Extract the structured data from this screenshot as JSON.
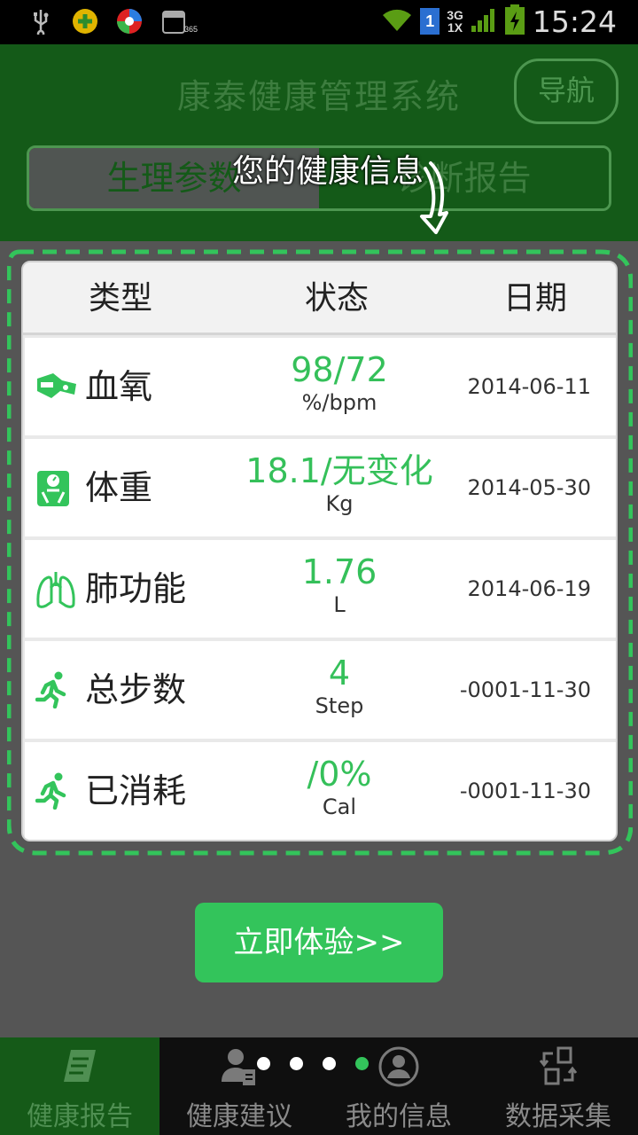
{
  "status_bar": {
    "time": "15:24",
    "network_top": "3G",
    "network_bottom": "1X",
    "sim": "1",
    "calendar_badge": "365",
    "icons": [
      "usb-icon",
      "plus-app-icon",
      "colorful-app-icon",
      "calendar-icon",
      "wifi-icon",
      "sim-icon",
      "signal-icon",
      "battery-charging-icon"
    ]
  },
  "header": {
    "title": "康泰健康管理系统",
    "nav_button": "导航",
    "tabs": [
      {
        "label": "生理参数",
        "active": true
      },
      {
        "label": "诊断报告",
        "active": false
      }
    ]
  },
  "overlay": {
    "hint": "您的健康信息",
    "arrow_icon": "curved-arrow-down-icon"
  },
  "table": {
    "headers": {
      "type": "类型",
      "status": "状态",
      "date": "日期"
    },
    "rows": [
      {
        "icon": "oximeter-icon",
        "type": "血氧",
        "value": "98/72",
        "unit": "%/bpm",
        "date": "2014-06-11"
      },
      {
        "icon": "scale-icon",
        "type": "体重",
        "value": "18.1/无变化",
        "unit": "Kg",
        "date": "2014-05-30"
      },
      {
        "icon": "lungs-icon",
        "type": "肺功能",
        "value": "1.76",
        "unit": "L",
        "date": "2014-06-19"
      },
      {
        "icon": "runner-icon",
        "type": "总步数",
        "value": "4",
        "unit": "Step",
        "date": "-0001-11-30"
      },
      {
        "icon": "runner-icon",
        "type": "已消耗",
        "value": "/0%",
        "unit": "Cal",
        "date": "-0001-11-30"
      }
    ]
  },
  "try_button": "立即体验>>",
  "page_indicator": {
    "count": 4,
    "active_index": 3
  },
  "tabbar": [
    {
      "label": "健康报告",
      "icon": "report-icon",
      "active": true
    },
    {
      "label": "健康建议",
      "icon": "advice-icon",
      "active": false
    },
    {
      "label": "我的信息",
      "icon": "profile-icon",
      "active": false
    },
    {
      "label": "数据采集",
      "icon": "data-collect-icon",
      "active": false
    }
  ],
  "colors": {
    "accent_green": "#33c45b",
    "header_green_dimmed": "#145a18",
    "overlay_gray": "#555555",
    "status_value_green": "#35c05a"
  }
}
